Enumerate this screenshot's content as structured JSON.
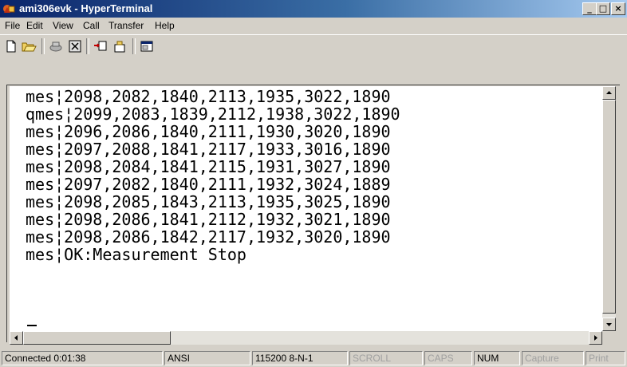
{
  "window": {
    "title": "ami306evk - HyperTerminal",
    "controls": {
      "minimize": "_",
      "maximize": "□",
      "close": "×"
    }
  },
  "menu": [
    "File",
    "Edit",
    "View",
    "Call",
    "Transfer",
    "Help"
  ],
  "toolbar": {
    "buttons": [
      "new-icon",
      "open-icon",
      "call-icon",
      "disconnect-icon",
      "send-icon",
      "receive-icon",
      "properties-icon"
    ]
  },
  "terminal": {
    "lines": [
      "mes¦2098,2082,1840,2113,1935,3022,1890",
      "qmes¦2099,2083,1839,2112,1938,3022,1890",
      "mes¦2096,2086,1840,2111,1930,3020,1890",
      "mes¦2097,2088,1841,2117,1933,3016,1890",
      "mes¦2098,2084,1841,2115,1931,3027,1890",
      "mes¦2097,2082,1840,2111,1932,3024,1889",
      "mes¦2098,2085,1843,2113,1935,3025,1890",
      "mes¦2098,2086,1841,2112,1932,3021,1890",
      "mes¦2098,2086,1842,2117,1932,3020,1890",
      "mes¦OK:Measurement Stop"
    ]
  },
  "status": {
    "connected": "Connected 0:01:38",
    "emulation": "ANSI",
    "settings": "115200 8-N-1",
    "scroll": "SCROLL",
    "caps": "CAPS",
    "num": "NUM",
    "capture": "Capture",
    "print": "Print"
  }
}
